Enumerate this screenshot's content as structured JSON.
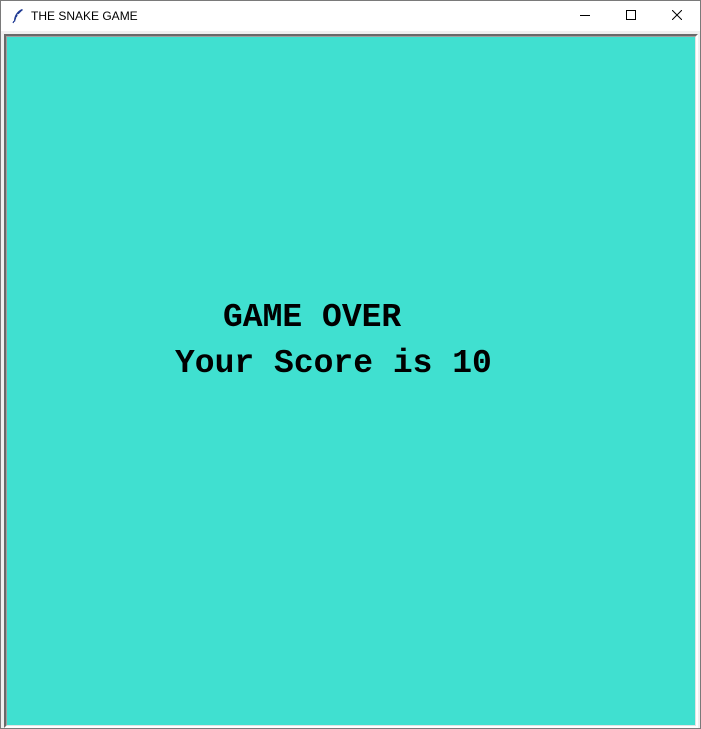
{
  "window": {
    "title": "THE SNAKE GAME",
    "app_icon": "feather-icon",
    "controls": {
      "minimize_icon": "minimize-icon",
      "maximize_icon": "maximize-icon",
      "close_icon": "close-icon"
    }
  },
  "game": {
    "background_color": "#40E0D0",
    "game_over_text": "GAME OVER",
    "score_text": "Your Score is 10",
    "score": 10
  }
}
